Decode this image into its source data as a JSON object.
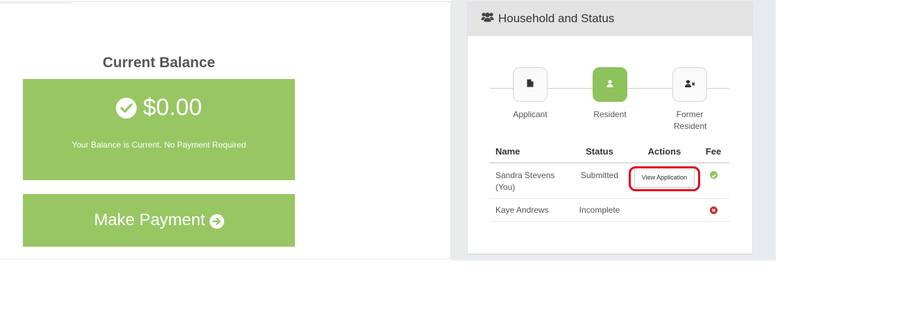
{
  "balance": {
    "title": "Current Balance",
    "amount": "$0.00",
    "message": "Your Balance is Current. No Payment Required",
    "status_icon": "check-circle-icon",
    "color": "#98c663"
  },
  "payment": {
    "label": "Make Payment",
    "icon": "arrow-circle-right-icon"
  },
  "household": {
    "title": "Household and Status",
    "icon": "users-icon",
    "steps": [
      {
        "label": "Applicant",
        "icon": "file-icon",
        "active": false
      },
      {
        "label": "Resident",
        "icon": "user-icon",
        "active": true
      },
      {
        "label": "Former Resident",
        "icon": "user-times-icon",
        "active": false
      }
    ],
    "table": {
      "headers": [
        "Name",
        "Status",
        "Actions",
        "Fee"
      ],
      "rows": [
        {
          "name": "Sandra Stevens (You)",
          "status": "Submitted",
          "action": "View Application",
          "fee": "paid",
          "fee_icon": "check-circle-icon",
          "fee_color": "#8dc25c"
        },
        {
          "name": "Kaye Andrews",
          "status": "Incomplete",
          "action": "",
          "fee": "unpaid",
          "fee_icon": "times-circle-icon",
          "fee_color": "#c9302c"
        }
      ]
    }
  },
  "colors": {
    "accent_green": "#98c663",
    "highlight_red": "#e3001b"
  }
}
